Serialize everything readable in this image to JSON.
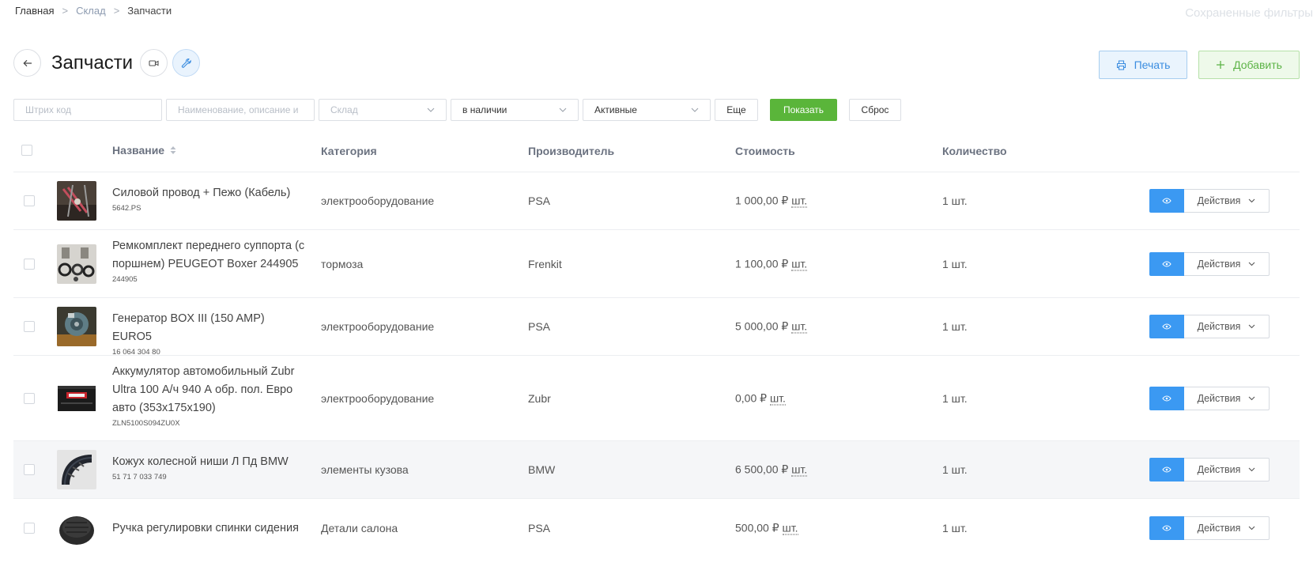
{
  "breadcrumb": {
    "home": "Главная",
    "sep1": ">",
    "warehouse": "Склад",
    "sep2": ">",
    "current": "Запчасти"
  },
  "saved_filters": "Сохраненные фильтры",
  "page": {
    "title": "Запчасти"
  },
  "actions": {
    "print": "Печать",
    "add": "Добавить"
  },
  "filters": {
    "barcode_placeholder": "Штрих код",
    "name_placeholder": "Наименование, описание и",
    "warehouse_placeholder": "Склад",
    "availability": "в наличии",
    "status": "Активные",
    "more": "Еще",
    "show": "Показать",
    "reset": "Сброс"
  },
  "table": {
    "headers": {
      "name": "Название",
      "category": "Категория",
      "manufacturer": "Производитель",
      "cost": "Стоимость",
      "quantity": "Количество"
    },
    "action_label": "Действия",
    "rows": [
      {
        "name": "Силовой провод + Пежо (Кабель)",
        "sku": "5642.PS",
        "category": "электрооборудование",
        "manufacturer": "PSA",
        "cost": "1 000,00 ₽",
        "unit": "шт.",
        "quantity": "1 шт."
      },
      {
        "name": "Ремкомплект переднего суппорта (с поршнем) PEUGEOT Boxer 244905",
        "sku": "244905",
        "category": "тормоза",
        "manufacturer": "Frenkit",
        "cost": "1 100,00 ₽",
        "unit": "шт.",
        "quantity": "1 шт."
      },
      {
        "name": "Генератор BOX III (150 AMP) EURO5",
        "sku": "16 064 304 80",
        "category": "электрооборудование",
        "manufacturer": "PSA",
        "cost": "5 000,00 ₽",
        "unit": "шт.",
        "quantity": "1 шт."
      },
      {
        "name": "Аккумулятор автомобильный Zubr Ultra 100 А/ч 940 А обр. пол. Евро авто (353x175x190)",
        "sku": "ZLN5100S094ZU0X",
        "category": "электрооборудование",
        "manufacturer": "Zubr",
        "cost": "0,00 ₽",
        "unit": "шт.",
        "quantity": "1 шт."
      },
      {
        "name": "Кожух колесной ниши Л Пд BMW",
        "sku": "51 71 7 033 749",
        "category": "элементы кузова",
        "manufacturer": "BMW",
        "cost": "6 500,00 ₽",
        "unit": "шт.",
        "quantity": "1 шт."
      },
      {
        "name": "Ручка регулировки спинки сидения",
        "sku": "",
        "category": "Детали салона",
        "manufacturer": "PSA",
        "cost": "500,00 ₽",
        "unit": "шт.",
        "quantity": "1 шт."
      }
    ]
  }
}
